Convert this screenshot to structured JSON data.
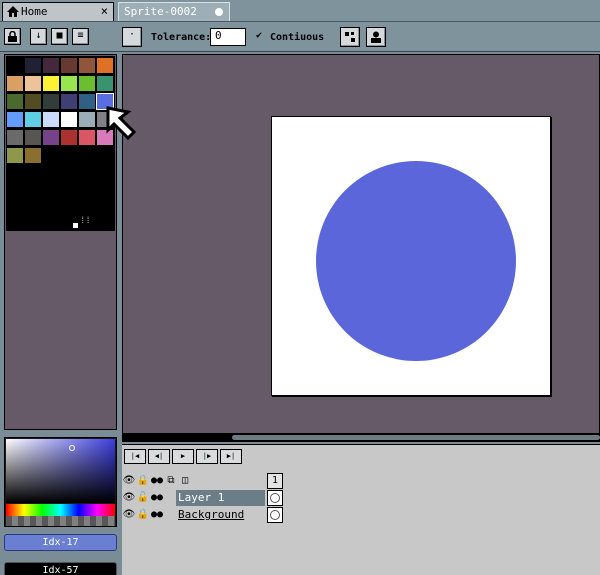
{
  "tabs": [
    {
      "label": "Home",
      "icon": "home-icon",
      "close": "×"
    },
    {
      "label": "Sprite-0002",
      "modified": true
    }
  ],
  "context_bar": {
    "tolerance_label": "Tolerance:",
    "tolerance_value": "0",
    "contiguous_label": "Contiuous",
    "contiguous_checked": true
  },
  "palette": {
    "selected_index": 17,
    "colors": [
      "#000000",
      "#222034",
      "#45283c",
      "#663931",
      "#8f563b",
      "#df7126",
      "#d9a066",
      "#eec39a",
      "#fbf236",
      "#99e550",
      "#6abe30",
      "#37946e",
      "#4b692f",
      "#524b24",
      "#323c39",
      "#3f3f74",
      "#306082",
      "#5b6ee1",
      "#639bff",
      "#5fcde4",
      "#cbdbfc",
      "#ffffff",
      "#9badb7",
      "#847e87",
      "#696a6a",
      "#595652",
      "#76428a",
      "#ac3232",
      "#d95763",
      "#d77bba",
      "#8f974a",
      "#8a6f30"
    ]
  },
  "colors": {
    "foreground_label": "Idx-17",
    "background_label": "Idx-57",
    "fill": "#5b66db",
    "canvas_bg": "#ffffff",
    "editor_bg": "#675a68"
  },
  "timeline": {
    "frame_number": "1",
    "layers": [
      {
        "name": "Layer 1",
        "selected": true
      },
      {
        "name": "Background",
        "selected": false
      }
    ]
  }
}
